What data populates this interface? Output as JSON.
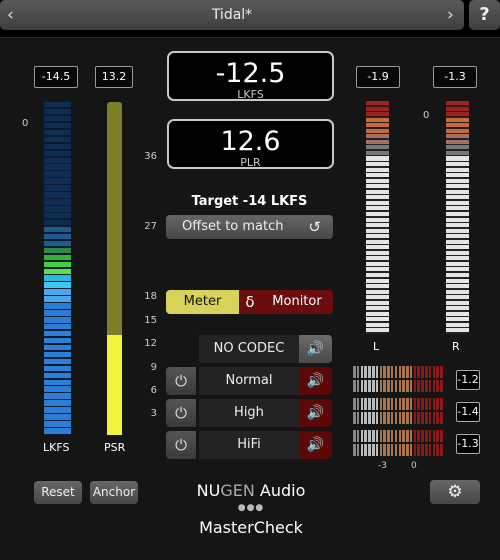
{
  "header": {
    "preset_name": "Tidal*",
    "prev_icon": "chevron-left-icon",
    "next_icon": "chevron-right-icon",
    "help_label": "?"
  },
  "left_meters": {
    "lkfs_value": "-14.5",
    "psr_value": "13.2",
    "top_scale": "0",
    "lkfs_label": "LKFS",
    "psr_label": "PSR"
  },
  "loudness": {
    "value": "-12.5",
    "unit": "LKFS"
  },
  "plr": {
    "value": "12.6",
    "unit": "PLR"
  },
  "target": {
    "text": "Target -14 LKFS",
    "offset_button": "Offset to match",
    "reset_icon": "rotate-ccw-icon"
  },
  "scale": [
    "36",
    "27",
    "18",
    "15",
    "12",
    "9",
    "6",
    "3"
  ],
  "mode": {
    "meter": "Meter",
    "delta": "δ",
    "monitor": "Monitor"
  },
  "codecs": [
    {
      "name": "NO CODEC",
      "power": false,
      "monitor_on": true
    },
    {
      "name": "Normal",
      "power": true,
      "monitor_on": false
    },
    {
      "name": "High",
      "power": true,
      "monitor_on": false
    },
    {
      "name": "HiFi",
      "power": true,
      "monitor_on": false
    }
  ],
  "right_meters": {
    "left_value": "-1.9",
    "right_value": "-1.3",
    "top_scale": "0",
    "left_label": "L",
    "right_label": "R"
  },
  "codec_meters": {
    "values": [
      "-1.2",
      "-1.4",
      "-1.3"
    ],
    "scale_low": "-3",
    "scale_high": "0"
  },
  "footer": {
    "reset": "Reset",
    "anchor": "Anchor",
    "brand_nu": "NU",
    "brand_gen": "GEN",
    "brand_audio": " Audio",
    "dots": "●●●",
    "product": "MasterCheck",
    "settings_icon": "gear-icon"
  },
  "colors": {
    "meter_button": "#d8d25a",
    "monitor_button": "#6a0d0d",
    "lkfs_bar": "#2a7fd6",
    "psr_bar": "#f2f23c",
    "peak_red": "#b02020"
  }
}
